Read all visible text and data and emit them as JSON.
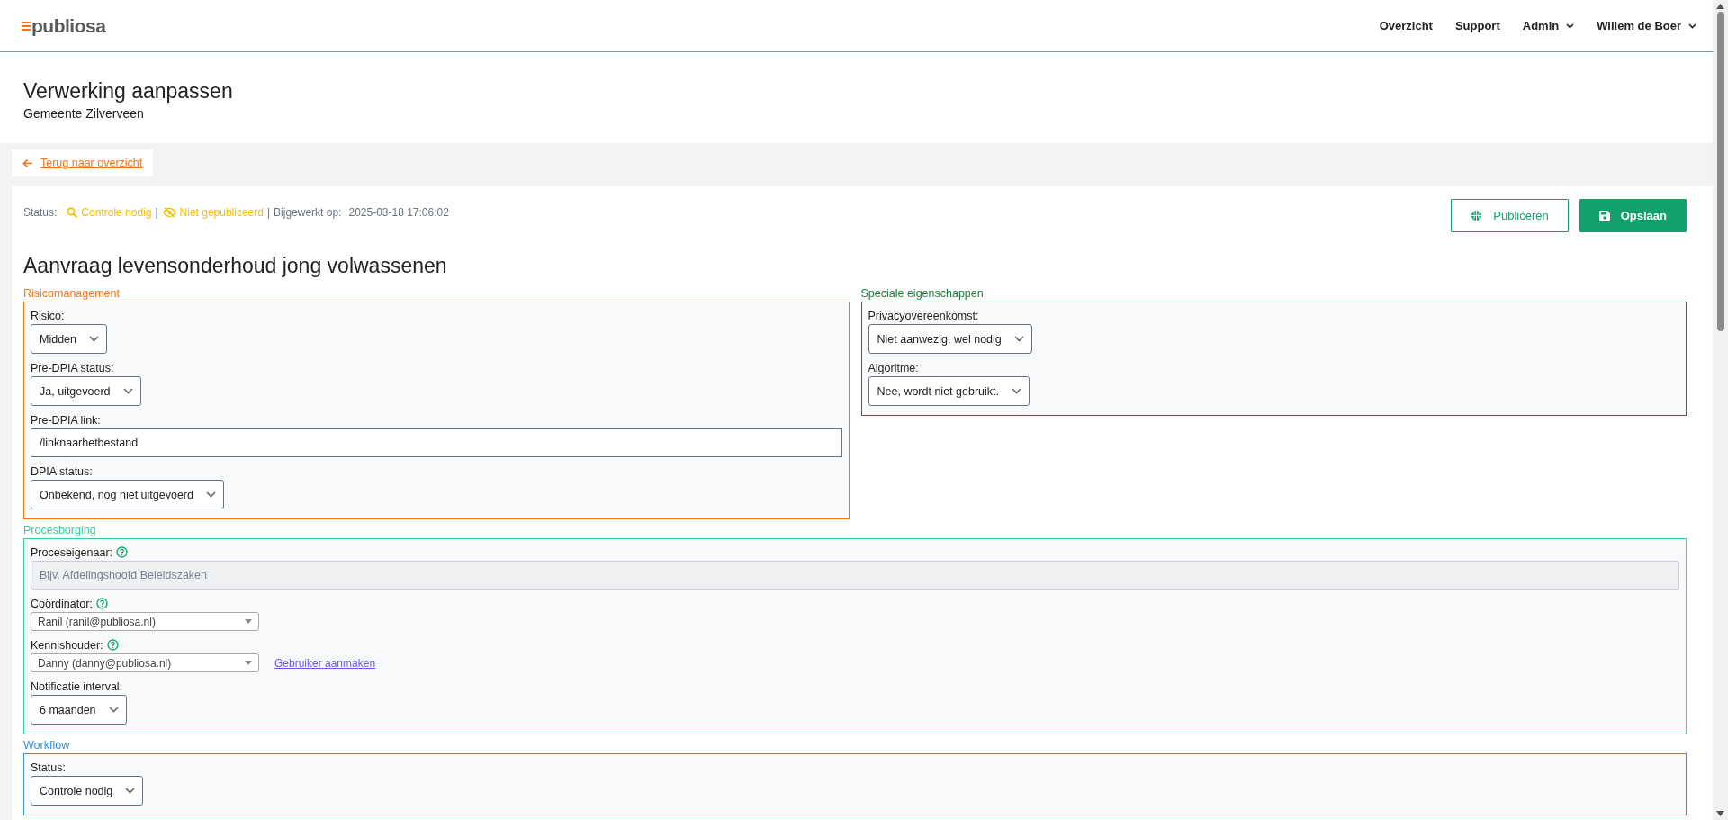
{
  "header": {
    "logo": "publiosa",
    "nav": [
      {
        "label": "Overzicht",
        "dropdown": false
      },
      {
        "label": "Support",
        "dropdown": false
      },
      {
        "label": "Admin",
        "dropdown": true
      },
      {
        "label": "Willem de Boer",
        "dropdown": true
      }
    ]
  },
  "page": {
    "title": "Verwerking aanpassen",
    "subtitle": "Gemeente Zilverveen"
  },
  "back_link": "Terug naar overzicht",
  "status": {
    "label": "Status:",
    "review": "Controle nodig",
    "separators": [
      "|",
      "|"
    ],
    "publication": "Niet gepubliceerd",
    "updated_label": "Bijgewerkt op:",
    "updated": "2025-03-18 17:06:02"
  },
  "actions": [
    {
      "label": "Publiceren",
      "kind": "outline"
    },
    {
      "label": "Opslaan",
      "kind": "primary"
    }
  ],
  "record_title": "Aanvraag levensonderhoud jong volwassenen",
  "rows": [
    [
      {
        "title": "Risicomanagement",
        "color": "#f97316",
        "fields": [
          {
            "kind": "select",
            "label": "Risico:",
            "value": "Midden"
          },
          {
            "kind": "select",
            "label": "Pre-DPIA status:",
            "value": "Ja, uitgevoerd"
          },
          {
            "kind": "text",
            "label": "Pre-DPIA link:",
            "value": "/linknaarhetbestand"
          },
          {
            "kind": "select",
            "label": "DPIA status:",
            "value": "Onbekend, nog niet uitgevoerd"
          }
        ]
      },
      {
        "title": "Speciale eigenschappen",
        "color": "#15803d",
        "fields": [
          {
            "kind": "select",
            "label": "Privacyovereenkomst:",
            "value": "Niet aanwezig, wel nodig"
          },
          {
            "kind": "select",
            "label": "Algoritme:",
            "value": "Nee, wordt niet gebruikt."
          }
        ]
      }
    ],
    [
      {
        "title": "Procesborging",
        "color": "#3ccaa0",
        "fields": [
          {
            "kind": "text",
            "label": "Proceseigenaar:",
            "help": true,
            "placeholder": "Bijv. Afdelingshoofd Beleidszaken",
            "disabled": true
          },
          {
            "kind": "combo",
            "label": "Coördinator:",
            "help": true,
            "value": "Ranil (ranil@publiosa.nl)"
          },
          {
            "kind": "combo",
            "label": "Kennishouder:",
            "help": true,
            "value": "Danny (danny@publiosa.nl)",
            "link": "Gebruiker aanmaken"
          },
          {
            "kind": "select",
            "label": "Notificatie interval:",
            "value": "6 maanden"
          }
        ]
      }
    ],
    [
      {
        "title": "Workflow",
        "color": "#3b8fd6",
        "fields": [
          {
            "kind": "select",
            "label": "Status:",
            "value": "Controle nodig"
          }
        ]
      }
    ]
  ]
}
